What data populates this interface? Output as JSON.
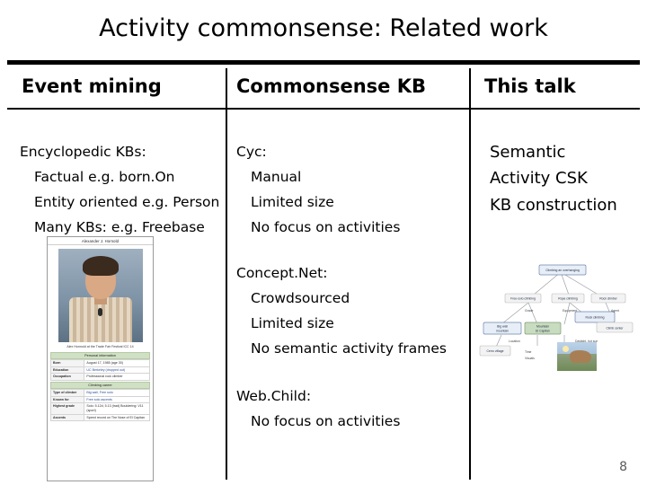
{
  "slide": {
    "title": "Activity commonsense: Related work",
    "page_number": "8"
  },
  "columns": {
    "headers": [
      "Event mining",
      "Commonsense KB",
      "This talk"
    ]
  },
  "event_mining": {
    "lines": [
      {
        "text": "Encyclopedic KBs:",
        "indent": 0
      },
      {
        "text": "Factual e.g. born.On",
        "indent": 1
      },
      {
        "text": "Entity oriented e.g. Person",
        "indent": 1
      },
      {
        "text": "Many KBs: e.g. Freebase",
        "indent": 1
      }
    ],
    "thumbnail": {
      "name": "wikipedia-article-screenshot",
      "page_title": "Alexander J. Hornold",
      "caption": "Alex Honnold at the Trade Fair Festival ICC 14",
      "section_heading": "Personal information",
      "info_rows": [
        {
          "key": "Born",
          "value": "August 17, 1985 (age 30)"
        },
        {
          "key": "Education",
          "value": "UC Berkeley (dropped out)"
        },
        {
          "key": "Occupation",
          "value": "Professional rock climber"
        }
      ],
      "section_heading2": "Climbing career",
      "info_rows2": [
        {
          "key": "Type of climber",
          "value": "Big wall, Free solo"
        },
        {
          "key": "Known for",
          "value": "Free solo ascents"
        },
        {
          "key": "Highest grade",
          "value": "Solo: 5.12d, 5.13 (trad) Bouldering: V11 (sport)"
        },
        {
          "key": "Ascents",
          "value": "Speed record on The Nose of El Capitan"
        }
      ]
    }
  },
  "commonsense_kb": {
    "block1": [
      {
        "text": "Cyc:",
        "indent": 0
      },
      {
        "text": "Manual",
        "indent": 1
      },
      {
        "text": "Limited size",
        "indent": 1
      },
      {
        "text": "No focus on activities",
        "indent": 1
      }
    ],
    "block2": [
      {
        "text": "Concept.Net:",
        "indent": 0
      },
      {
        "text": "Crowdsourced",
        "indent": 1
      },
      {
        "text": "Limited size",
        "indent": 1
      },
      {
        "text": "No semantic activity frames",
        "indent": 1
      }
    ],
    "block3": [
      {
        "text": "Web.Child:",
        "indent": 0
      },
      {
        "text": "No focus on activities",
        "indent": 1
      }
    ]
  },
  "this_talk": {
    "lines": [
      "Semantic",
      "Activity  CSK",
      "KB construction"
    ],
    "diagram": {
      "name": "knowledge-graph-diagram",
      "nodes": [
        "Climbing an overhanging",
        "Free-solo climbing",
        "Rope climbing",
        "Rock climber",
        "Big wall climbing",
        "Mountain",
        "El Capitan",
        "Rock climbing",
        "Grade",
        "Equipment",
        "Location",
        "Agent",
        "Time",
        "Cerro torre  village",
        "Climb   center",
        "Woods",
        "Daylight, hot sun"
      ],
      "accent_colors": {
        "node_fill": "#e8eef7",
        "node_stroke": "#6b86ad",
        "highlight_fill": "#c8dcc0",
        "edge": "#9aa0a6"
      }
    }
  }
}
